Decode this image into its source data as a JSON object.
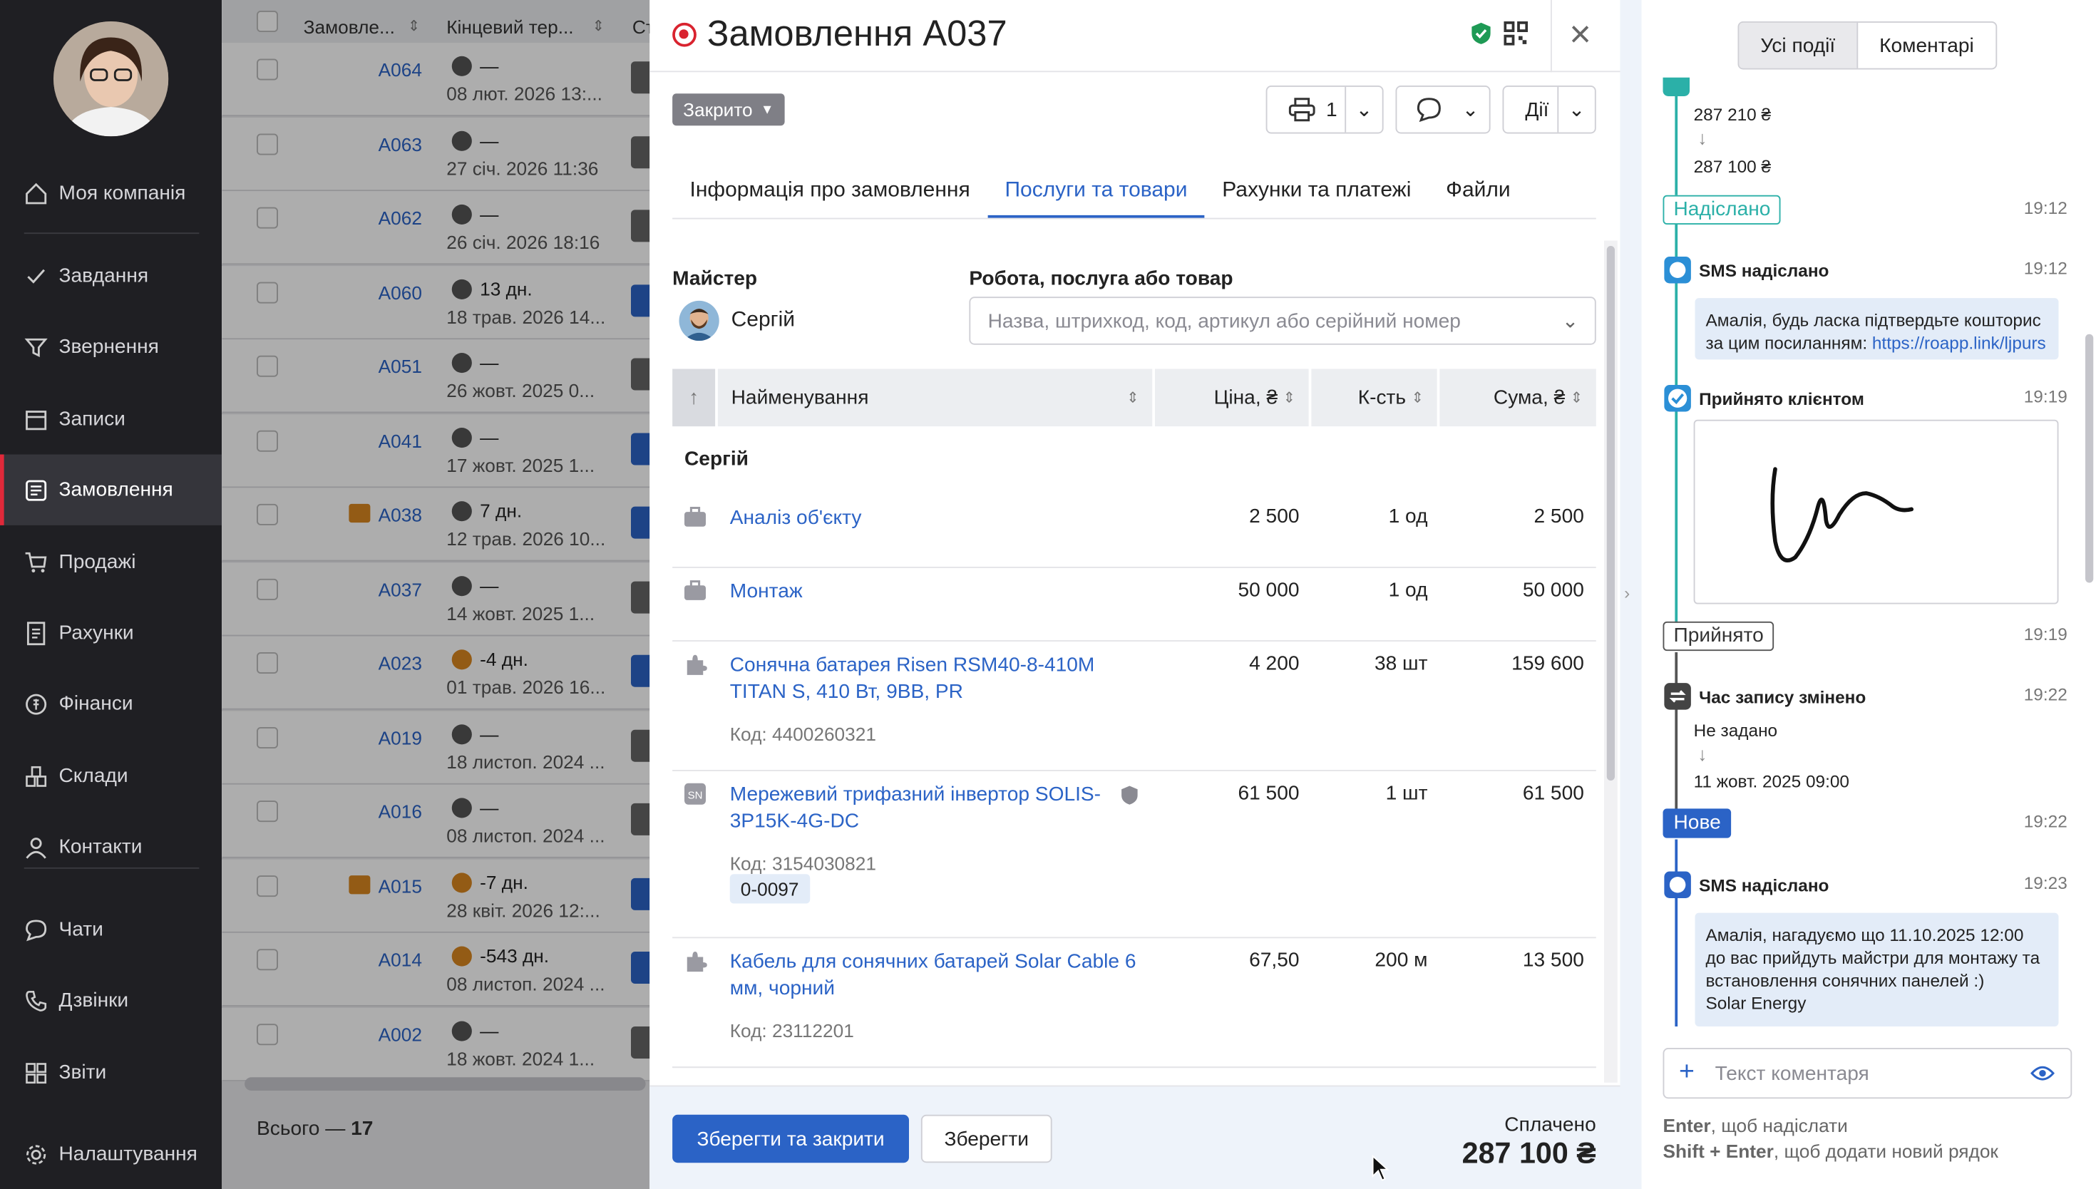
{
  "sidebar": {
    "items": [
      {
        "label": "Моя компанія",
        "icon": "home-icon"
      },
      {
        "label": "Завдання",
        "icon": "check-icon"
      },
      {
        "label": "Звернення",
        "icon": "funnel-icon"
      },
      {
        "label": "Записи",
        "icon": "calendar-icon"
      },
      {
        "label": "Замовлення",
        "icon": "orders-icon",
        "active": true
      },
      {
        "label": "Продажі",
        "icon": "cart-icon"
      },
      {
        "label": "Рахунки",
        "icon": "invoice-icon"
      },
      {
        "label": "Фінанси",
        "icon": "coin-icon"
      },
      {
        "label": "Склади",
        "icon": "warehouse-icon"
      },
      {
        "label": "Контакти",
        "icon": "contacts-icon"
      },
      {
        "label": "Чати",
        "icon": "chat-icon"
      },
      {
        "label": "Дзвінки",
        "icon": "phone-icon"
      },
      {
        "label": "Звіти",
        "icon": "reports-icon"
      },
      {
        "label": "Налаштування",
        "icon": "gear-icon"
      }
    ]
  },
  "orders_list": {
    "columns": [
      "Замовле...",
      "Кінцевий тер...",
      "Ст"
    ],
    "rows": [
      {
        "id": "A064",
        "t1": "—",
        "t2": "08 лют. 2026 13:..."
      },
      {
        "id": "A063",
        "t1": "—",
        "t2": "27 січ. 2026 11:36"
      },
      {
        "id": "A062",
        "t1": "—",
        "t2": "26 січ. 2026 18:16"
      },
      {
        "id": "A060",
        "t1": "13 дн.",
        "t2": "18 трав. 2026 14..."
      },
      {
        "id": "A051",
        "t1": "—",
        "t2": "26 жовт. 2025 0..."
      },
      {
        "id": "A041",
        "t1": "—",
        "t2": "17 жовт. 2025 1..."
      },
      {
        "id": "A038",
        "t1": "7 дн.",
        "t2": "12 трав. 2026 10..."
      },
      {
        "id": "A037",
        "t1": "—",
        "t2": "14 жовт. 2025 1..."
      },
      {
        "id": "A023",
        "t1": "-4 дн.",
        "t2": "01 трав. 2026 16..."
      },
      {
        "id": "A019",
        "t1": "—",
        "t2": "18 листоп. 2024 ..."
      },
      {
        "id": "A016",
        "t1": "—",
        "t2": "08 листоп. 2024 ..."
      },
      {
        "id": "A015",
        "t1": "-7 дн.",
        "t2": "28 квіт. 2026 12:..."
      },
      {
        "id": "A014",
        "t1": "-543 дн.",
        "t2": "08 листоп. 2024 ..."
      },
      {
        "id": "A002",
        "t1": "—",
        "t2": "18 жовт. 2024 1..."
      }
    ],
    "footer_label": "Всього — ",
    "footer_count": "17"
  },
  "order": {
    "title": "Замовлення A037",
    "status": "Закрито",
    "print_count": "1",
    "actions_label": "Дії",
    "tabs": [
      "Інформація про замовлення",
      "Послуги та товари",
      "Рахунки та платежі",
      "Файли"
    ],
    "master_label": "Майстер",
    "master_name": "Сергій",
    "work_label": "Робота, послуга або товар",
    "search_placeholder": "Назва, штрихкод, код, артикул або серійний номер",
    "columns": {
      "name": "Найменування",
      "price": "Ціна, ₴",
      "qty": "К-сть",
      "sum": "Сума, ₴"
    },
    "group": "Сергій",
    "items": [
      {
        "name": "Аналіз об'єкту",
        "code": "",
        "price": "2 500",
        "qty": "1 од",
        "sum": "2 500",
        "icon": "service-icon"
      },
      {
        "name": "Монтаж",
        "code": "",
        "price": "50 000",
        "qty": "1 од",
        "sum": "50 000",
        "icon": "service-icon"
      },
      {
        "name": "Сонячна батарея Risen RSM40-8-410M TITAN S, 410 Вт, 9BB, PR",
        "code": "Код: 4400260321",
        "price": "4 200",
        "qty": "38 шт",
        "sum": "159 600",
        "icon": "product-icon"
      },
      {
        "name": "Мережевий трифазний інвертор SOLIS-3P15K-4G-DC",
        "code": "Код: 3154030821",
        "serial": "0-0097",
        "price": "61 500",
        "qty": "1 шт",
        "sum": "61 500",
        "icon": "sn-icon"
      },
      {
        "name": "Кабель для сонячних батарей Solar Cable 6 мм, чорний",
        "code": "Код: 23112201",
        "price": "67,50",
        "qty": "200 м",
        "sum": "13 500",
        "icon": "product-icon"
      }
    ],
    "save_close_label": "Зберегти та закрити",
    "save_label": "Зберегти",
    "paid_label": "Сплачено",
    "paid_value": "287 100 ₴"
  },
  "feed": {
    "tabs": [
      "Усі події",
      "Коментарі"
    ],
    "events": {
      "sum_old": "287 210 ₴",
      "sum_new": "287 100 ₴",
      "sent_badge": "Надіслано",
      "sent_time": "19:12",
      "sms1_title": "SMS надіслано",
      "sms1_time": "19:12",
      "sms1_text": "Амалія, будь ласка підтвердьте кошторис за цим посиланням: ",
      "sms1_link": "https://roapp.link/ljpurs",
      "accepted_title": "Прийнято клієнтом",
      "accepted_time": "19:19",
      "accepted_badge": "Прийнято",
      "accepted_badge_time": "19:19",
      "time_changed_title": "Час запису змінено",
      "time_changed_time": "19:22",
      "time_old": "Не задано",
      "time_new": "11 жовт. 2025 09:00",
      "new_badge": "Нове",
      "new_time": "19:22",
      "sms2_title": "SMS надіслано",
      "sms2_time": "19:23",
      "sms2_text": "Амалія, нагадуємо що 11.10.2025 12:00 до вас прийдуть майстри для монтажу та встановлення сонячних панелей :)",
      "sms2_sign": "Solar Energy"
    },
    "comment_placeholder": "Текст коментаря",
    "hint1_key": "Enter",
    "hint1_text": ", щоб надіслати",
    "hint2_key": "Shift + Enter",
    "hint2_text": ", щоб додати новий рядок"
  }
}
